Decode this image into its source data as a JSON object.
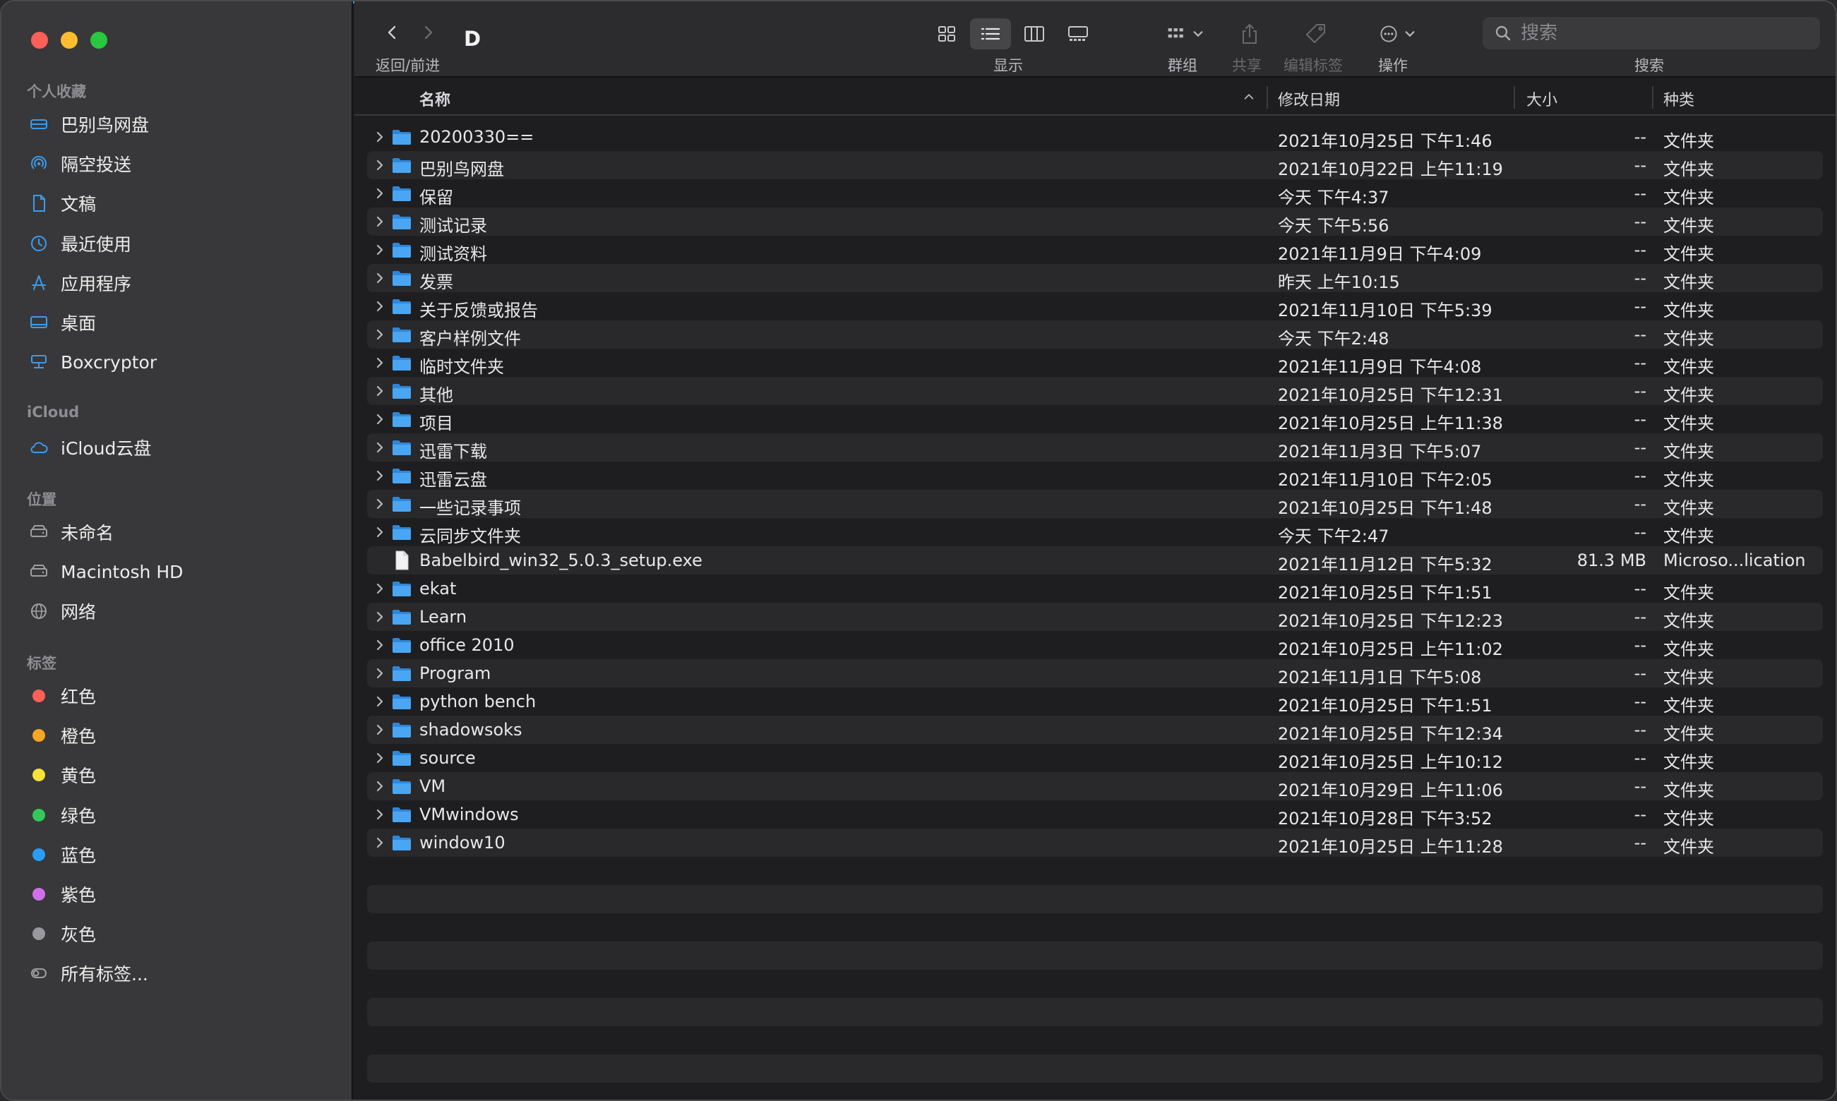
{
  "sidebar": {
    "sections": [
      {
        "title": "个人收藏",
        "items": [
          {
            "label": "巴别鸟网盘",
            "icon": "drive-icon"
          },
          {
            "label": "隔空投送",
            "icon": "airdrop-icon"
          },
          {
            "label": "文稿",
            "icon": "document-icon"
          },
          {
            "label": "最近使用",
            "icon": "clock-icon"
          },
          {
            "label": "应用程序",
            "icon": "apps-icon"
          },
          {
            "label": "桌面",
            "icon": "desktop-icon"
          },
          {
            "label": "Boxcryptor",
            "icon": "boxcryptor-icon"
          }
        ]
      },
      {
        "title": "iCloud",
        "items": [
          {
            "label": "iCloud云盘",
            "icon": "cloud-icon"
          }
        ]
      },
      {
        "title": "位置",
        "items": [
          {
            "label": "未命名",
            "icon": "disk-icon"
          },
          {
            "label": "Macintosh HD",
            "icon": "disk-icon"
          },
          {
            "label": "网络",
            "icon": "network-icon"
          }
        ]
      },
      {
        "title": "标签",
        "items": [
          {
            "label": "红色",
            "color": "#fe5f57"
          },
          {
            "label": "橙色",
            "color": "#f5a623"
          },
          {
            "label": "黄色",
            "color": "#f7e23a"
          },
          {
            "label": "绿色",
            "color": "#34c759"
          },
          {
            "label": "蓝色",
            "color": "#2a9df4"
          },
          {
            "label": "紫色",
            "color": "#d070e8"
          },
          {
            "label": "灰色",
            "color": "#98989d"
          },
          {
            "label": "所有标签...",
            "icon": "all-tags-icon"
          }
        ]
      }
    ]
  },
  "toolbar": {
    "title": "D",
    "back_forward_label": "返回/前进",
    "view_label": "显示",
    "group_label": "群组",
    "share_label": "共享",
    "edit_tags_label": "编辑标签",
    "action_label": "操作",
    "search_label": "搜索",
    "search_placeholder": "搜索"
  },
  "columns": {
    "name": "名称",
    "date": "修改日期",
    "size": "大小",
    "kind": "种类"
  },
  "files": [
    {
      "name": "20200330==",
      "date": "2021年10月25日 下午1:46",
      "size": "--",
      "kind": "文件夹",
      "type": "folder"
    },
    {
      "name": "巴别鸟网盘",
      "date": "2021年10月22日 上午11:19",
      "size": "--",
      "kind": "文件夹",
      "type": "folder"
    },
    {
      "name": "保留",
      "date": "今天 下午4:37",
      "size": "--",
      "kind": "文件夹",
      "type": "folder"
    },
    {
      "name": "测试记录",
      "date": "今天 下午5:56",
      "size": "--",
      "kind": "文件夹",
      "type": "folder"
    },
    {
      "name": "测试资料",
      "date": "2021年11月9日 下午4:09",
      "size": "--",
      "kind": "文件夹",
      "type": "folder"
    },
    {
      "name": "发票",
      "date": "昨天 上午10:15",
      "size": "--",
      "kind": "文件夹",
      "type": "folder"
    },
    {
      "name": "关于反馈或报告",
      "date": "2021年11月10日 下午5:39",
      "size": "--",
      "kind": "文件夹",
      "type": "folder"
    },
    {
      "name": "客户样例文件",
      "date": "今天 下午2:48",
      "size": "--",
      "kind": "文件夹",
      "type": "folder"
    },
    {
      "name": "临时文件夹",
      "date": "2021年11月9日 下午4:08",
      "size": "--",
      "kind": "文件夹",
      "type": "folder"
    },
    {
      "name": "其他",
      "date": "2021年10月25日 下午12:31",
      "size": "--",
      "kind": "文件夹",
      "type": "folder"
    },
    {
      "name": "项目",
      "date": "2021年10月25日 上午11:38",
      "size": "--",
      "kind": "文件夹",
      "type": "folder"
    },
    {
      "name": "迅雷下载",
      "date": "2021年11月3日 下午5:07",
      "size": "--",
      "kind": "文件夹",
      "type": "folder"
    },
    {
      "name": "迅雷云盘",
      "date": "2021年11月10日 下午2:05",
      "size": "--",
      "kind": "文件夹",
      "type": "folder"
    },
    {
      "name": "一些记录事项",
      "date": "2021年10月25日 下午1:48",
      "size": "--",
      "kind": "文件夹",
      "type": "folder"
    },
    {
      "name": "云同步文件夹",
      "date": "今天 下午2:47",
      "size": "--",
      "kind": "文件夹",
      "type": "folder"
    },
    {
      "name": "Babelbird_win32_5.0.3_setup.exe",
      "date": "2021年11月12日 下午5:32",
      "size": "81.3 MB",
      "kind": "Microso...lication",
      "type": "file"
    },
    {
      "name": "ekat",
      "date": "2021年10月25日 下午1:51",
      "size": "--",
      "kind": "文件夹",
      "type": "folder"
    },
    {
      "name": "Learn",
      "date": "2021年10月25日 下午12:23",
      "size": "--",
      "kind": "文件夹",
      "type": "folder"
    },
    {
      "name": "office 2010",
      "date": "2021年10月25日 上午11:02",
      "size": "--",
      "kind": "文件夹",
      "type": "folder"
    },
    {
      "name": "Program",
      "date": "2021年11月1日 下午5:08",
      "size": "--",
      "kind": "文件夹",
      "type": "folder"
    },
    {
      "name": "python bench",
      "date": "2021年10月25日 下午1:51",
      "size": "--",
      "kind": "文件夹",
      "type": "folder"
    },
    {
      "name": "shadowsoks",
      "date": "2021年10月25日 下午12:34",
      "size": "--",
      "kind": "文件夹",
      "type": "folder"
    },
    {
      "name": "source",
      "date": "2021年10月25日 上午10:12",
      "size": "--",
      "kind": "文件夹",
      "type": "folder"
    },
    {
      "name": "VM",
      "date": "2021年10月29日 上午11:06",
      "size": "--",
      "kind": "文件夹",
      "type": "folder"
    },
    {
      "name": "VMwindows",
      "date": "2021年10月28日 下午3:52",
      "size": "--",
      "kind": "文件夹",
      "type": "folder"
    },
    {
      "name": "window10",
      "date": "2021年10月25日 上午11:28",
      "size": "--",
      "kind": "文件夹",
      "type": "folder"
    }
  ],
  "colors": {
    "accent": "#2a9df4",
    "folder": "#3d9be9"
  }
}
